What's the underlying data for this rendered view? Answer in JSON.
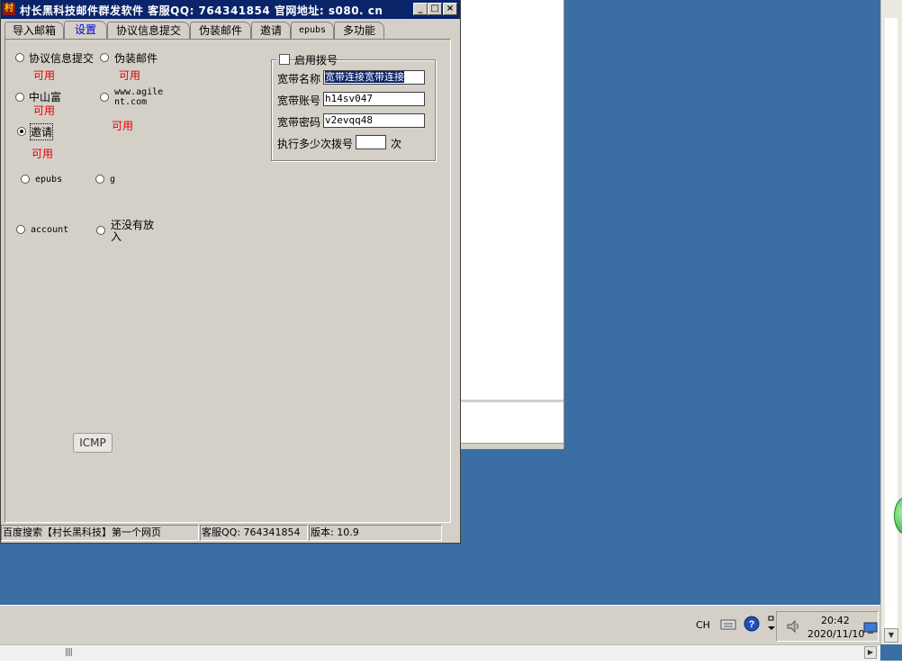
{
  "window": {
    "title": "村长黑科技邮件群发软件   客服QQ: 764341854   官网地址: s080. cn",
    "icon_text": "村"
  },
  "tabs": [
    "导入邮箱",
    "设置",
    "协议信息提交",
    "伪装邮件",
    "邀请",
    "epubs",
    "多功能"
  ],
  "active_tab": "设置",
  "modules": [
    {
      "label": "协议信息提交",
      "status": "可用"
    },
    {
      "label": "伪装邮件",
      "status": "可用"
    },
    {
      "label": "中山富",
      "status": "可用"
    },
    {
      "label": "www.agilent.com",
      "status": "可用"
    },
    {
      "label": "邀请",
      "status": "可用",
      "checked": true
    },
    {
      "label": "epubs"
    },
    {
      "label": "g"
    },
    {
      "label": "account"
    },
    {
      "label": "还没有放入"
    }
  ],
  "dial": {
    "enable_label": "启用拨号",
    "name_label": "宽带名称",
    "name_value": "宽带连接宽带连接",
    "account_label": "宽带账号",
    "account_value": "h14sv047",
    "password_label": "宽带密码",
    "password_value": "v2evqq48",
    "times_label": "执行多少次拨号",
    "times_value": "",
    "times_unit": "次"
  },
  "icmp_button": "ICMP",
  "statusbar": {
    "left": "百度搜索【村长黑科技】第一个网页",
    "qq": "客服QQ: 764341854",
    "version": "版本: 10.9"
  },
  "taskbar": {
    "lang": "CH",
    "time": "20:42",
    "date": "2020/11/10"
  },
  "colors": {
    "titlebar": "#0a246a",
    "available": "#e00000",
    "active_tab": "#0000cc",
    "desktop": "#3a6ea5"
  }
}
